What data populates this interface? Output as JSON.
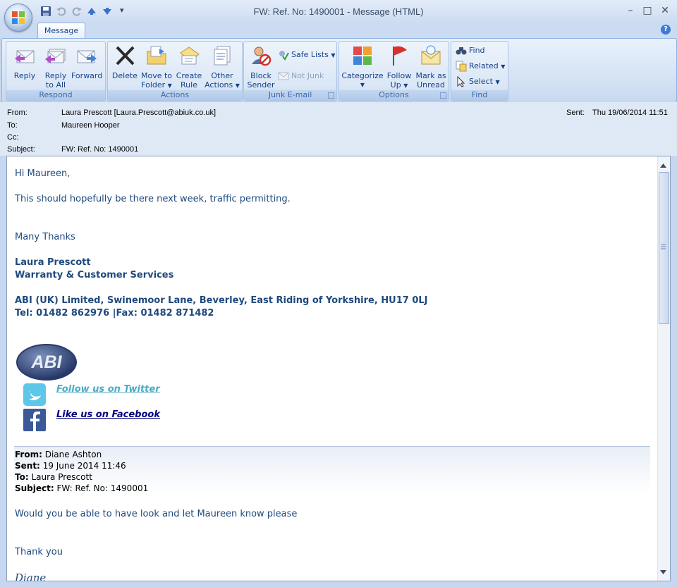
{
  "window": {
    "title": "FW: Ref. No:  1490001 - Message (HTML)",
    "minimize": "–",
    "maximize": "□",
    "close": "✕"
  },
  "quick_access": {
    "more": "▾"
  },
  "ribbon": {
    "tab": "Message",
    "help": "?",
    "groups": {
      "respond": {
        "title": "Respond",
        "reply": [
          "Reply",
          ""
        ],
        "reply_all": [
          "Reply",
          "to All"
        ],
        "forward": [
          "Forward",
          ""
        ]
      },
      "actions": {
        "title": "Actions",
        "delete": [
          "Delete",
          ""
        ],
        "move": [
          "Move to",
          "Folder"
        ],
        "create_rule": [
          "Create",
          "Rule"
        ],
        "other": [
          "Other",
          "Actions"
        ]
      },
      "junk": {
        "title": "Junk E-mail",
        "block": [
          "Block",
          "Sender"
        ],
        "safe_lists": "Safe Lists",
        "not_junk": "Not Junk"
      },
      "options": {
        "title": "Options",
        "categorize": [
          "Categorize",
          ""
        ],
        "follow_up": [
          "Follow",
          "Up"
        ],
        "mark_unread": [
          "Mark as",
          "Unread"
        ]
      },
      "find": {
        "title": "Find",
        "find": "Find",
        "related": "Related",
        "select": "Select"
      }
    }
  },
  "header": {
    "from_label": "From:",
    "from": "Laura Prescott [Laura.Prescott@abiuk.co.uk]",
    "to_label": "To:",
    "to": "Maureen Hooper",
    "cc_label": "Cc:",
    "cc": "",
    "subject_label": "Subject:",
    "subject": "FW: Ref. No:  1490001",
    "sent_label": "Sent:",
    "sent": "Thu 19/06/2014 11:51"
  },
  "body": {
    "greeting": "Hi Maureen,",
    "line1": "This should hopefully be there next week, traffic permitting.",
    "thanks": "Many Thanks",
    "sig_name": "Laura Prescott",
    "sig_dept": "Warranty & Customer Services",
    "sig_address": "ABI (UK) Limited, Swinemoor Lane, Beverley, East Riding of Yorkshire, HU17 0LJ",
    "sig_phone": "Tel: 01482 862976 |Fax: 01482 871482",
    "logo_text": "ABI",
    "twitter": "Follow us on Twitter",
    "facebook": "Like us on Facebook",
    "fwd": {
      "from_label": "From:",
      "from": "Diane Ashton",
      "sent_label": "Sent:",
      "sent": "19 June 2014 11:46",
      "to_label": "To:",
      "to": "Laura Prescott",
      "subject_label": "Subject:",
      "subject": "FW: Ref. No: 1490001"
    },
    "fwd_line": "Would you be able to have look and let Maureen know please",
    "fwd_thanks": "Thank you",
    "fwd_sig": "Diane"
  },
  "colors": {
    "body_text": "#1f497d",
    "link_twitter": "#4bacc6",
    "link_facebook": "#000080"
  }
}
